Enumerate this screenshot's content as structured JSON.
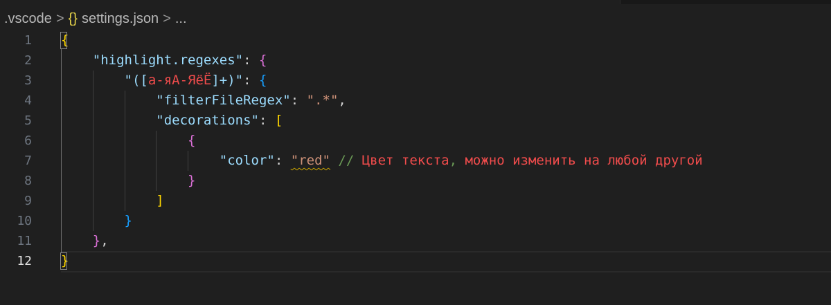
{
  "breadcrumb": {
    "folder": ".vscode",
    "file_icon": "{}",
    "file": "settings.json",
    "more": "...",
    "separator": ">"
  },
  "line_numbers": [
    "1",
    "2",
    "3",
    "4",
    "5",
    "6",
    "7",
    "8",
    "9",
    "10",
    "11",
    "12"
  ],
  "active_line": "12",
  "lines": [
    [
      {
        "t": "{",
        "c": "b1"
      }
    ],
    [
      {
        "t": "    "
      },
      {
        "t": "\"highlight.regexes\"",
        "c": "k"
      },
      {
        "t": ": ",
        "c": "p"
      },
      {
        "t": "{",
        "c": "b2"
      }
    ],
    [
      {
        "t": "        "
      },
      {
        "t": "\"([",
        "c": "k"
      },
      {
        "t": "а-яА-ЯёЁ",
        "c": "r"
      },
      {
        "t": "]+)\"",
        "c": "k"
      },
      {
        "t": ": ",
        "c": "p"
      },
      {
        "t": "{",
        "c": "b3"
      }
    ],
    [
      {
        "t": "            "
      },
      {
        "t": "\"filterFileRegex\"",
        "c": "k"
      },
      {
        "t": ": ",
        "c": "p"
      },
      {
        "t": "\".*\"",
        "c": "s"
      },
      {
        "t": ",",
        "c": "p"
      }
    ],
    [
      {
        "t": "            "
      },
      {
        "t": "\"decorations\"",
        "c": "k"
      },
      {
        "t": ": ",
        "c": "p"
      },
      {
        "t": "[",
        "c": "b1"
      }
    ],
    [
      {
        "t": "                "
      },
      {
        "t": "{",
        "c": "b2"
      }
    ],
    [
      {
        "t": "                    "
      },
      {
        "t": "\"color\"",
        "c": "k"
      },
      {
        "t": ": ",
        "c": "p"
      },
      {
        "t": "\"red\"",
        "c": "s warn"
      },
      {
        "t": " "
      },
      {
        "t": "//",
        "c": "cm"
      },
      {
        "t": " Цвет текста",
        "c": "cr"
      },
      {
        "t": ",",
        "c": "cm"
      },
      {
        "t": " можно изменить на любой другой",
        "c": "cr"
      }
    ],
    [
      {
        "t": "                "
      },
      {
        "t": "}",
        "c": "b2"
      }
    ],
    [
      {
        "t": "            "
      },
      {
        "t": "]",
        "c": "b1"
      }
    ],
    [
      {
        "t": "        "
      },
      {
        "t": "}",
        "c": "b3"
      }
    ],
    [
      {
        "t": "    "
      },
      {
        "t": "}",
        "c": "b2"
      },
      {
        "t": ",",
        "c": "p"
      }
    ],
    [
      {
        "t": "}",
        "c": "b1"
      }
    ]
  ]
}
